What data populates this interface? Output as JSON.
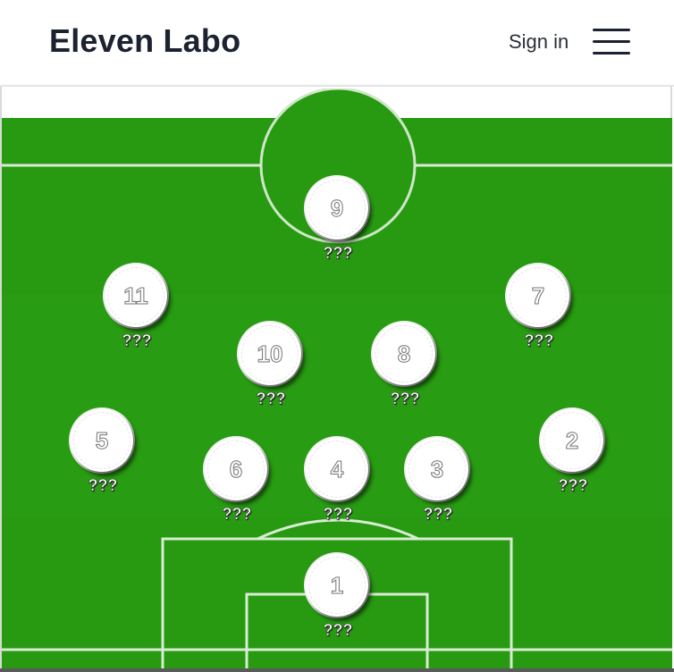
{
  "header": {
    "brand": "Eleven Labo",
    "signin_label": "Sign in",
    "menu_icon": "hamburger-menu-icon"
  },
  "colors": {
    "pitch": "#279a12",
    "lines": "#d8ecd2",
    "brand_text": "#1c2230"
  },
  "players": [
    {
      "number": "9",
      "name": "???"
    },
    {
      "number": "11",
      "name": "???"
    },
    {
      "number": "7",
      "name": "???"
    },
    {
      "number": "10",
      "name": "???"
    },
    {
      "number": "8",
      "name": "???"
    },
    {
      "number": "5",
      "name": "???"
    },
    {
      "number": "2",
      "name": "???"
    },
    {
      "number": "6",
      "name": "???"
    },
    {
      "number": "4",
      "name": "???"
    },
    {
      "number": "3",
      "name": "???"
    },
    {
      "number": "1",
      "name": "???"
    }
  ]
}
